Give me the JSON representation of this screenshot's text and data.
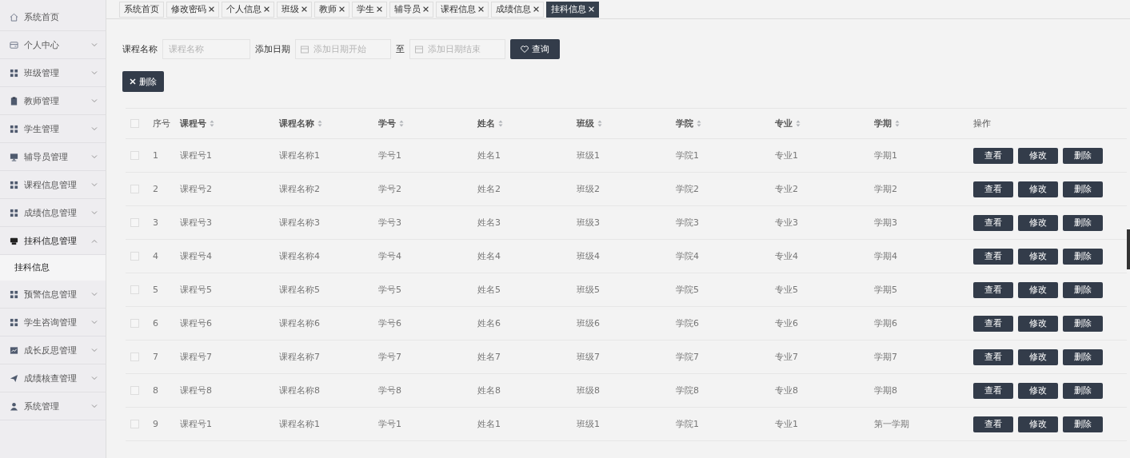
{
  "tabs": [
    {
      "label": "系统首页",
      "closable": false,
      "selected": false
    },
    {
      "label": "修改密码",
      "closable": true,
      "selected": false
    },
    {
      "label": "个人信息",
      "closable": true,
      "selected": false
    },
    {
      "label": "班级",
      "closable": true,
      "selected": false
    },
    {
      "label": "教师",
      "closable": true,
      "selected": false
    },
    {
      "label": "学生",
      "closable": true,
      "selected": false
    },
    {
      "label": "辅导员",
      "closable": true,
      "selected": false
    },
    {
      "label": "课程信息",
      "closable": true,
      "selected": false
    },
    {
      "label": "成绩信息",
      "closable": true,
      "selected": false
    },
    {
      "label": "挂科信息",
      "closable": true,
      "selected": true
    }
  ],
  "sidebar": {
    "items": [
      {
        "label": "系统首页",
        "kind": "link"
      },
      {
        "label": "个人中心",
        "kind": "menu",
        "expanded": false
      },
      {
        "label": "班级管理",
        "kind": "menu",
        "expanded": false
      },
      {
        "label": "教师管理",
        "kind": "menu",
        "expanded": false
      },
      {
        "label": "学生管理",
        "kind": "menu",
        "expanded": false
      },
      {
        "label": "辅导员管理",
        "kind": "menu",
        "expanded": false
      },
      {
        "label": "课程信息管理",
        "kind": "menu",
        "expanded": false
      },
      {
        "label": "成绩信息管理",
        "kind": "menu",
        "expanded": false
      },
      {
        "label": "挂科信息管理",
        "kind": "menu",
        "expanded": true,
        "children": [
          {
            "label": "挂科信息",
            "selected": true
          }
        ]
      },
      {
        "label": "预警信息管理",
        "kind": "menu",
        "expanded": false
      },
      {
        "label": "学生咨询管理",
        "kind": "menu",
        "expanded": false
      },
      {
        "label": "成长反思管理",
        "kind": "menu",
        "expanded": false
      },
      {
        "label": "成绩核查管理",
        "kind": "menu",
        "expanded": false
      },
      {
        "label": "系统管理",
        "kind": "menu",
        "expanded": false
      }
    ]
  },
  "search": {
    "name_label": "课程名称",
    "name_placeholder": "课程名称",
    "date_label": "添加日期",
    "start_placeholder": "添加日期开始",
    "separator": "至",
    "end_placeholder": "添加日期结束",
    "search_button": "查询"
  },
  "delete_button": "删除",
  "table": {
    "columns": [
      {
        "label": "序号",
        "sortable": false
      },
      {
        "label": "课程号",
        "sortable": true
      },
      {
        "label": "课程名称",
        "sortable": true
      },
      {
        "label": "学号",
        "sortable": true
      },
      {
        "label": "姓名",
        "sortable": true
      },
      {
        "label": "班级",
        "sortable": true
      },
      {
        "label": "学院",
        "sortable": true
      },
      {
        "label": "专业",
        "sortable": true
      },
      {
        "label": "学期",
        "sortable": true
      },
      {
        "label": "操作",
        "sortable": false
      }
    ],
    "all_checked": false,
    "rows": [
      {
        "checked": false,
        "cells": [
          "1",
          "课程号1",
          "课程名称1",
          "学号1",
          "姓名1",
          "班级1",
          "学院1",
          "专业1",
          "学期1"
        ],
        "actions": [
          "查看",
          "修改",
          "删除"
        ]
      },
      {
        "checked": false,
        "cells": [
          "2",
          "课程号2",
          "课程名称2",
          "学号2",
          "姓名2",
          "班级2",
          "学院2",
          "专业2",
          "学期2"
        ],
        "actions": [
          "查看",
          "修改",
          "删除"
        ]
      },
      {
        "checked": false,
        "cells": [
          "3",
          "课程号3",
          "课程名称3",
          "学号3",
          "姓名3",
          "班级3",
          "学院3",
          "专业3",
          "学期3"
        ],
        "actions": [
          "查看",
          "修改",
          "删除"
        ]
      },
      {
        "checked": false,
        "cells": [
          "4",
          "课程号4",
          "课程名称4",
          "学号4",
          "姓名4",
          "班级4",
          "学院4",
          "专业4",
          "学期4"
        ],
        "actions": [
          "查看",
          "修改",
          "删除"
        ]
      },
      {
        "checked": false,
        "cells": [
          "5",
          "课程号5",
          "课程名称5",
          "学号5",
          "姓名5",
          "班级5",
          "学院5",
          "专业5",
          "学期5"
        ],
        "actions": [
          "查看",
          "修改",
          "删除"
        ]
      },
      {
        "checked": false,
        "cells": [
          "6",
          "课程号6",
          "课程名称6",
          "学号6",
          "姓名6",
          "班级6",
          "学院6",
          "专业6",
          "学期6"
        ],
        "actions": [
          "查看",
          "修改",
          "删除"
        ]
      },
      {
        "checked": false,
        "cells": [
          "7",
          "课程号7",
          "课程名称7",
          "学号7",
          "姓名7",
          "班级7",
          "学院7",
          "专业7",
          "学期7"
        ],
        "actions": [
          "查看",
          "修改",
          "删除"
        ]
      },
      {
        "checked": false,
        "cells": [
          "8",
          "课程号8",
          "课程名称8",
          "学号8",
          "姓名8",
          "班级8",
          "学院8",
          "专业8",
          "学期8"
        ],
        "actions": [
          "查看",
          "修改",
          "删除"
        ]
      },
      {
        "checked": false,
        "cells": [
          "9",
          "课程号1",
          "课程名称1",
          "学号1",
          "姓名1",
          "班级1",
          "学院1",
          "专业1",
          "第一学期"
        ],
        "actions": [
          "查看",
          "修改",
          "删除"
        ]
      }
    ]
  }
}
